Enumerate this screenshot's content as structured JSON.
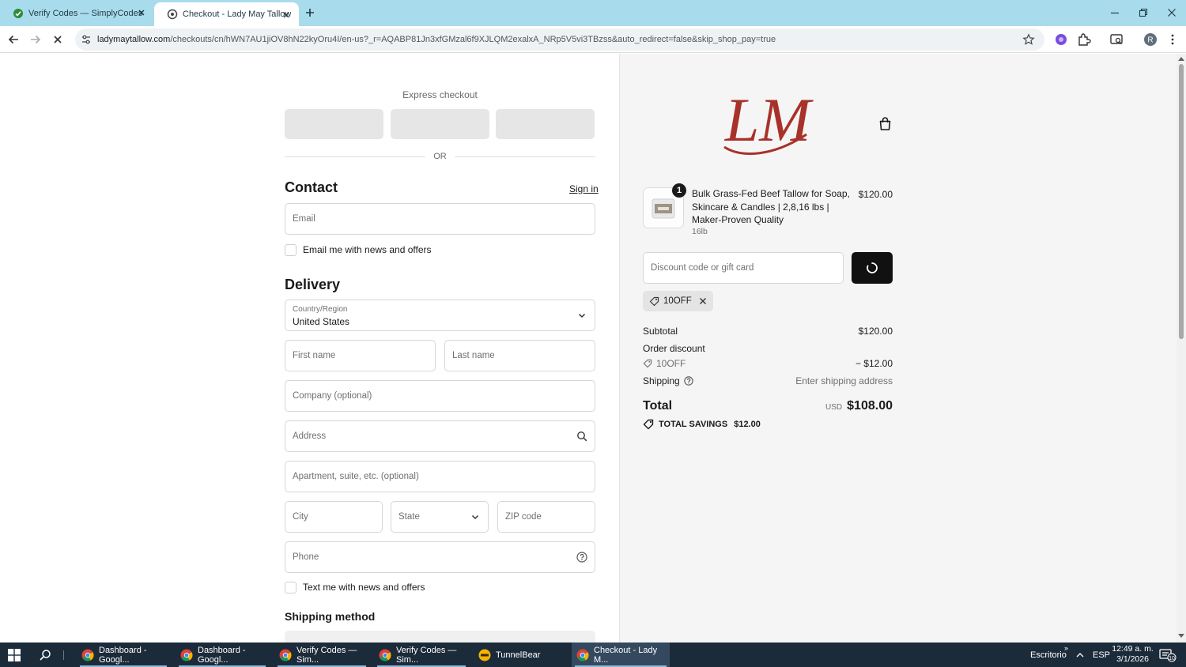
{
  "browser": {
    "tabs": [
      {
        "title": "Verify Codes — SimplyCodes",
        "icon": "simplycodes-icon"
      },
      {
        "title": "Checkout - Lady May Tallow",
        "icon": "site-icon"
      }
    ],
    "url_host": "ladymaytallow.com",
    "url_path": "/checkouts/cn/hWN7AU1jiOV8hN22kyOru4I/en-us?_r=AQABP81Jn3xfGMzal6f9XJLQM2exalxA_NRp5V5vi3TBzss&auto_redirect=false&skip_shop_pay=true",
    "profile_initial": "R"
  },
  "checkout": {
    "express_title": "Express checkout",
    "or_label": "OR",
    "contact_heading": "Contact",
    "sign_in": "Sign in",
    "email_placeholder": "Email",
    "email_news_label": "Email me with news and offers",
    "delivery_heading": "Delivery",
    "country_label": "Country/Region",
    "country_value": "United States",
    "first_name": "First name",
    "last_name": "Last name",
    "company": "Company (optional)",
    "address": "Address",
    "apartment": "Apartment, suite, etc. (optional)",
    "city": "City",
    "state": "State",
    "zip": "ZIP code",
    "phone": "Phone",
    "text_news_label": "Text me with news and offers",
    "shipping_method_heading": "Shipping method"
  },
  "order": {
    "logo_text": "LM",
    "quantity": "1",
    "product_title": "Bulk Grass-Fed Beef Tallow for Soap, Skincare & Candles | 2,8,16 lbs | Maker-Proven Quality",
    "product_variant": "16lb",
    "product_price": "$120.00",
    "discount_placeholder": "Discount code or gift card",
    "applied_code": "10OFF",
    "subtotal_label": "Subtotal",
    "subtotal_value": "$120.00",
    "order_discount_label": "Order discount",
    "discount_code": "10OFF",
    "discount_value": "− $12.00",
    "shipping_label": "Shipping",
    "shipping_value": "Enter shipping address",
    "total_label": "Total",
    "total_currency": "USD",
    "total_value": "$108.00",
    "savings_label": "TOTAL SAVINGS",
    "savings_value": "$12.00"
  },
  "taskbar": {
    "apps": [
      "Dashboard - Googl...",
      "Dashboard - Googl...",
      "Verify Codes — Sim...",
      "Verify Codes — Sim...",
      "TunnelBear",
      "Checkout - Lady M..."
    ],
    "desktop_label": "Escritorio",
    "language": "ESP",
    "time": "12:49 a. m.",
    "date": "3/1/2026",
    "notification_count": "10"
  },
  "colors": {
    "tabbar": "#a8dcec",
    "right_pane": "#f5f5f5",
    "logo": "#a8322a",
    "taskbar": "#1c2b3a"
  }
}
